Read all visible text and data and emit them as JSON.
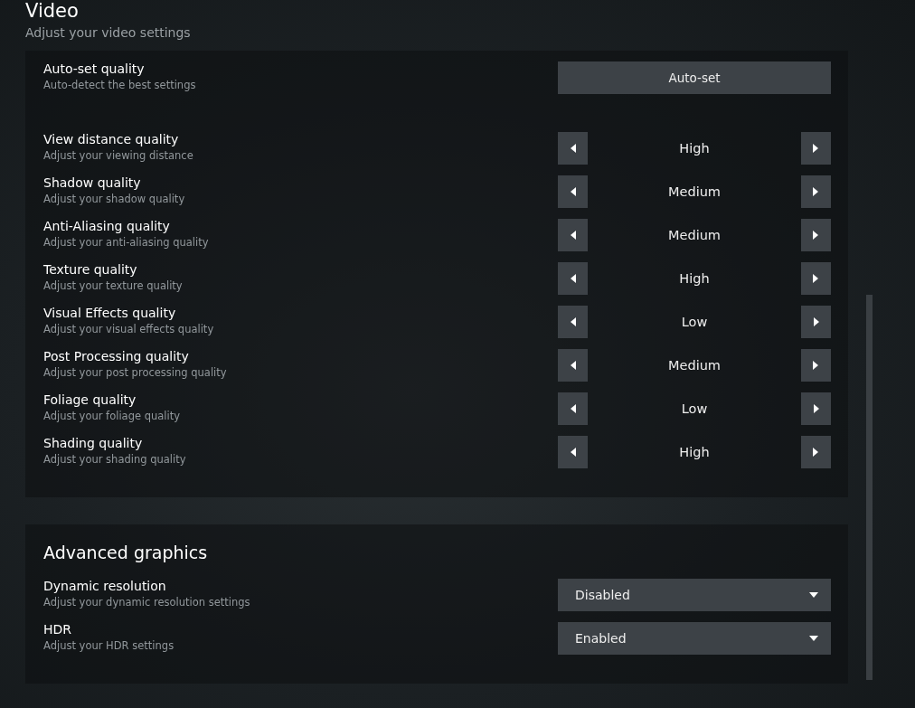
{
  "header": {
    "title": "Video",
    "subtitle": "Adjust your video settings"
  },
  "auto_set": {
    "label": "Auto-set quality",
    "description": "Auto-detect the best settings",
    "button": "Auto-set"
  },
  "quality_settings": [
    {
      "label": "View distance quality",
      "description": "Adjust your viewing distance",
      "value": "High"
    },
    {
      "label": "Shadow quality",
      "description": "Adjust your shadow quality",
      "value": "Medium"
    },
    {
      "label": "Anti-Aliasing quality",
      "description": "Adjust your anti-aliasing quality",
      "value": "Medium"
    },
    {
      "label": "Texture quality",
      "description": "Adjust your texture quality",
      "value": "High"
    },
    {
      "label": "Visual Effects quality",
      "description": "Adjust your visual effects quality",
      "value": "Low"
    },
    {
      "label": "Post Processing quality",
      "description": "Adjust your post processing quality",
      "value": "Medium"
    },
    {
      "label": "Foliage quality",
      "description": "Adjust your foliage quality",
      "value": "Low"
    },
    {
      "label": "Shading quality",
      "description": "Adjust your shading quality",
      "value": "High"
    }
  ],
  "advanced": {
    "title": "Advanced graphics",
    "settings": [
      {
        "label": "Dynamic resolution",
        "description": "Adjust your dynamic resolution settings",
        "value": "Disabled"
      },
      {
        "label": "HDR",
        "description": "Adjust your HDR settings",
        "value": "Enabled"
      }
    ]
  }
}
